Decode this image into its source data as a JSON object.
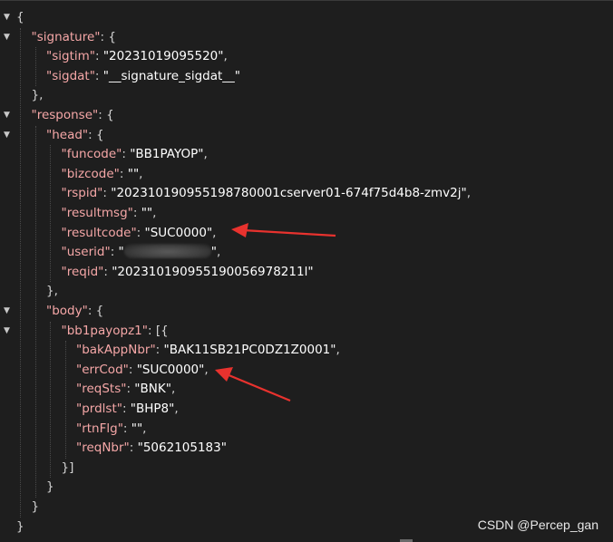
{
  "lines": [
    {
      "indent": 0,
      "toggle": true,
      "text": "{"
    },
    {
      "indent": 1,
      "toggle": true,
      "key": "\"signature\"",
      "sep": ": {"
    },
    {
      "indent": 2,
      "toggle": false,
      "key": "\"sigtim\"",
      "sep": ": ",
      "value": "\"20231019095520\"",
      "end": ","
    },
    {
      "indent": 2,
      "toggle": false,
      "key": "\"sigdat\"",
      "sep": ": ",
      "value": "\"__signature_sigdat__\""
    },
    {
      "indent": 1,
      "toggle": false,
      "text": "},"
    },
    {
      "indent": 1,
      "toggle": true,
      "key": "\"response\"",
      "sep": ": {"
    },
    {
      "indent": 2,
      "toggle": true,
      "key": "\"head\"",
      "sep": ": {"
    },
    {
      "indent": 3,
      "toggle": false,
      "key": "\"funcode\"",
      "sep": ": ",
      "value": "\"BB1PAYOP\"",
      "end": ","
    },
    {
      "indent": 3,
      "toggle": false,
      "key": "\"bizcode\"",
      "sep": ": ",
      "value": "\"\"",
      "end": ","
    },
    {
      "indent": 3,
      "toggle": false,
      "key": "\"rspid\"",
      "sep": ": ",
      "value": "\"202310190955198780001cserver01-674f75d4b8-zmv2j\"",
      "end": ","
    },
    {
      "indent": 3,
      "toggle": false,
      "key": "\"resultmsg\"",
      "sep": ": ",
      "value": "\"\"",
      "end": ","
    },
    {
      "indent": 3,
      "toggle": false,
      "key": "\"resultcode\"",
      "sep": ": ",
      "value": "\"SUC0000\"",
      "end": ","
    },
    {
      "indent": 3,
      "toggle": false,
      "key": "\"userid\"",
      "sep": ": ",
      "value": "\"",
      "blurred": true,
      "value2": "\"",
      "end": ","
    },
    {
      "indent": 3,
      "toggle": false,
      "key": "\"reqid\"",
      "sep": ": ",
      "value": "\"202310190955190056978211l\""
    },
    {
      "indent": 2,
      "toggle": false,
      "text": "},"
    },
    {
      "indent": 2,
      "toggle": true,
      "key": "\"body\"",
      "sep": ": {"
    },
    {
      "indent": 3,
      "toggle": true,
      "key": "\"bb1payopz1\"",
      "sep": ": [{"
    },
    {
      "indent": 4,
      "toggle": false,
      "key": "\"bakAppNbr\"",
      "sep": ": ",
      "value": "\"BAK11SB21PC0DZ1Z0001\"",
      "end": ","
    },
    {
      "indent": 4,
      "toggle": false,
      "key": "\"errCod\"",
      "sep": ": ",
      "value": "\"SUC0000\"",
      "end": ","
    },
    {
      "indent": 4,
      "toggle": false,
      "key": "\"reqSts\"",
      "sep": ": ",
      "value": "\"BNK\"",
      "end": ","
    },
    {
      "indent": 4,
      "toggle": false,
      "key": "\"prdlst\"",
      "sep": ": ",
      "value": "\"BHP8\"",
      "end": ","
    },
    {
      "indent": 4,
      "toggle": false,
      "key": "\"rtnFlg\"",
      "sep": ": ",
      "value": "\"\"",
      "end": ","
    },
    {
      "indent": 4,
      "toggle": false,
      "key": "\"reqNbr\"",
      "sep": ": ",
      "value": "\"5062105183\""
    },
    {
      "indent": 3,
      "toggle": false,
      "text": "}]"
    },
    {
      "indent": 2,
      "toggle": false,
      "text": "}"
    },
    {
      "indent": 1,
      "toggle": false,
      "text": "}"
    },
    {
      "indent": 0,
      "toggle": false,
      "text": "}"
    }
  ],
  "watermark": "CSDN @Percep_gan",
  "colors": {
    "background": "#1e1e1e",
    "key": "#f5a7a7",
    "value": "#ffffff",
    "punctuation": "#d4d4d4",
    "arrow": "#e8322e"
  },
  "icons": {
    "toggle": "caret-down-icon"
  }
}
